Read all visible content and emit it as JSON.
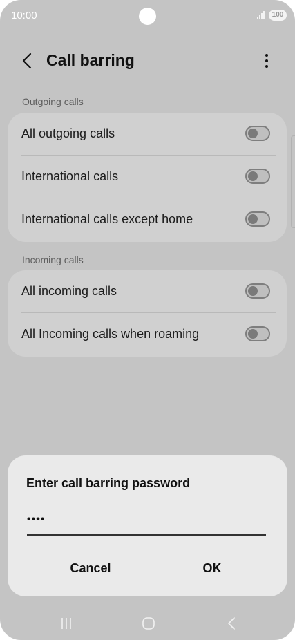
{
  "status": {
    "time": "10:00",
    "battery": "100"
  },
  "appbar": {
    "title": "Call barring"
  },
  "sections": [
    {
      "header": "Outgoing calls",
      "items": [
        {
          "label": "All outgoing calls",
          "enabled": false
        },
        {
          "label": "International calls",
          "enabled": false
        },
        {
          "label": "International calls except home",
          "enabled": false
        }
      ]
    },
    {
      "header": "Incoming calls",
      "items": [
        {
          "label": "All incoming calls",
          "enabled": false
        },
        {
          "label": "All Incoming calls when roaming",
          "enabled": false
        }
      ]
    }
  ],
  "dialog": {
    "title": "Enter call barring password",
    "password_mask": "••••",
    "cancel_label": "Cancel",
    "ok_label": "OK"
  },
  "icons": {
    "back": "chevron-left-icon",
    "more": "more-vertical-icon",
    "nav_recents": "recents-icon",
    "nav_home": "home-icon",
    "nav_back": "back-nav-icon"
  },
  "colors": {
    "dim_background": "#c4c4c4",
    "card": "#d0d0d0",
    "dialog": "#eaeaea"
  }
}
